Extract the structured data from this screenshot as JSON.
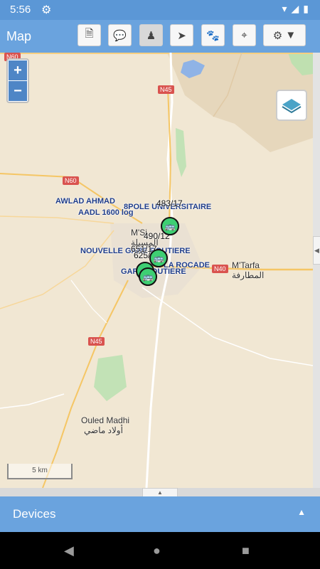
{
  "status_bar": {
    "time": "5:56"
  },
  "app_bar": {
    "title": "Map"
  },
  "map": {
    "zoom_in": "+",
    "zoom_out": "−",
    "scale": "5 km",
    "road_labels": [
      "N60",
      "N45",
      "N60",
      "N40",
      "N45"
    ],
    "places": {
      "ouled_madhi": "Ouled Madhi",
      "ouled_madhi_ar": "أولاد ماضي",
      "mtarfa": "M'Tarfa",
      "mtarfa_ar": "المطارفة",
      "msila": "M'Si",
      "msila_ar": "المسيلة"
    },
    "device_labels": {
      "awlad_ahmad": "AWLAD AHMAD",
      "aadl": "AADL 1600 log",
      "pole": "8POLE UNIVERSITAIRE",
      "nouvelle": "NOUVELLE GARE ROUTIERE",
      "rocade": "LA ROCADE",
      "gare": "GARE ROUTIERE"
    },
    "vehicle_numbers": [
      "483/17",
      "490/12",
      "651/17",
      "625/12"
    ]
  },
  "bottom_panel": {
    "label": "Devices"
  }
}
